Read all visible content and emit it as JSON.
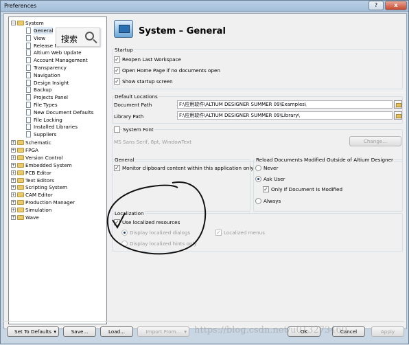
{
  "window": {
    "title": "Preferences",
    "help_label": "?",
    "close_label": "x"
  },
  "search_overlay": {
    "label": "搜索",
    "icon": "magnifier-icon"
  },
  "tree": {
    "root": "System",
    "system_children": [
      "General",
      "View",
      "Release M",
      "Altium Web Update",
      "Account Management",
      "Transparency",
      "Navigation",
      "Design Insight",
      "Backup",
      "Projects Panel",
      "File Types",
      "New Document Defaults",
      "File Locking",
      "Installed Libraries",
      "Suppliers"
    ],
    "top_level": [
      "Schematic",
      "FPGA",
      "Version Control",
      "Embedded System",
      "PCB Editor",
      "Text Editors",
      "Scripting System",
      "CAM Editor",
      "Production Manager",
      "Simulation",
      "Wave"
    ]
  },
  "header": {
    "title": "System – General",
    "icon": "monitor-icon"
  },
  "startup": {
    "title": "Startup",
    "reopen_label": "Reopen Last Workspace",
    "reopen_checked": true,
    "homepage_label": "Open Home Page if no documents open",
    "homepage_checked": true,
    "splash_label": "Show startup screen",
    "splash_checked": true
  },
  "default_locations": {
    "title": "Default Locations",
    "doc_path_label": "Document Path",
    "doc_path_value": "F:\\应用软件\\ALTIUM DESIGNER SUMMER 09\\Examples\\",
    "lib_path_label": "Library Path",
    "lib_path_value": "F:\\应用软件\\ALTIUM DESIGNER SUMMER 09\\Library\\"
  },
  "system_font": {
    "label": "System Font",
    "checked": false,
    "font_text": "MS Sans Serif, 8pt, WindowText",
    "change_label": "Change..."
  },
  "general": {
    "title": "General",
    "monitor_label": "Monitor clipboard content within this application only",
    "monitor_checked": true
  },
  "reload": {
    "title": "Reload Documents Modified Outside of Altium Designer",
    "never_label": "Never",
    "ask_label": "Ask User",
    "ask_selected": true,
    "only_modified_label": "Only If Document Is Modified",
    "only_modified_checked": true,
    "always_label": "Always"
  },
  "localization": {
    "title": "Localization",
    "use_label": "Use localized resources",
    "use_checked": true,
    "dialogs_label": "Display localized dialogs",
    "dialogs_selected": true,
    "hints_label": "Display localized hints only",
    "menus_label": "Localized menus",
    "menus_checked": true
  },
  "footer": {
    "set_defaults": "Set To Defaults",
    "save": "Save...",
    "load": "Load...",
    "import": "Import From...",
    "ok": "OK",
    "cancel": "Cancel",
    "apply": "Apply"
  },
  "watermark": "https://blog.csdn.net/u013273460"
}
